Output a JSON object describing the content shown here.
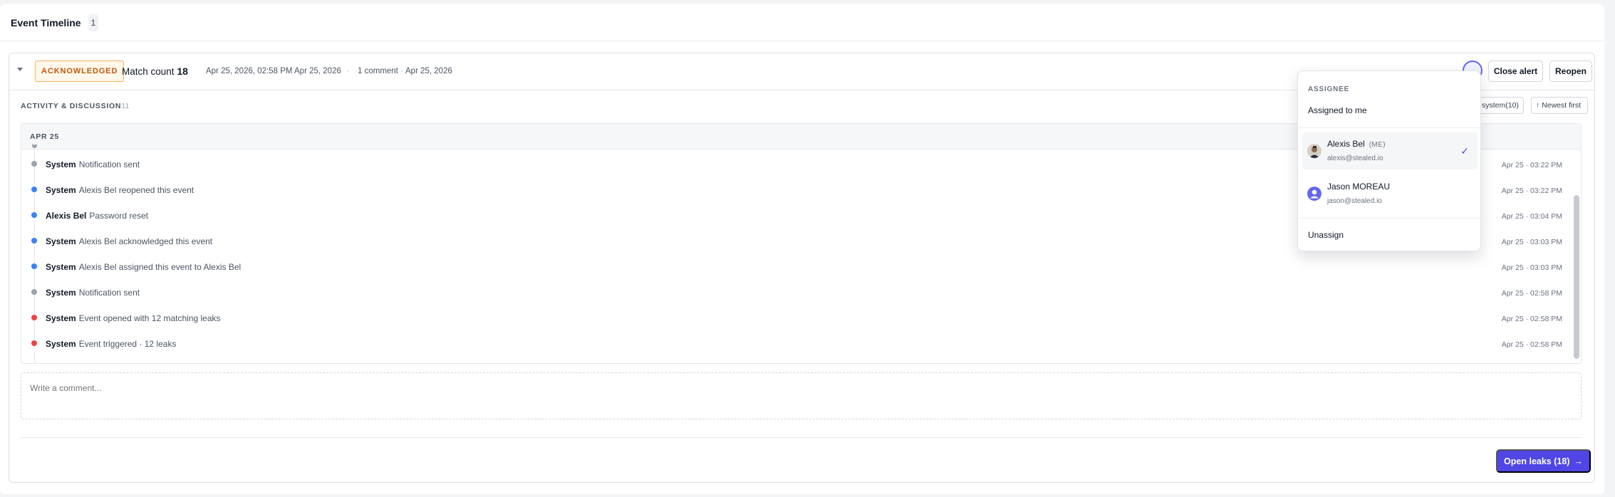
{
  "section": {
    "title": "Event Timeline",
    "count": "1"
  },
  "event": {
    "status": "ACKNOWLEDGED",
    "match_label": "Match count",
    "match_count": "18",
    "first_seen": "Apr 25, 2026, 02:58 PM",
    "last_seen": "Apr 25, 2026",
    "comments": "1 comment",
    "comment_date": "Apr 25, 2026",
    "sep": "·",
    "buttons": {
      "close": "Close alert",
      "reopen": "Reopen"
    }
  },
  "activity": {
    "title": "ACTIVITY & DISCUSSION",
    "count": "· 11",
    "filter_system": "system(10)",
    "sort": "↑ Newest first",
    "date_group": "APR 25",
    "items": [
      {
        "actor": "System",
        "text": "Notification sent",
        "time": "Apr 25 · 03:22 PM",
        "color": "#9ca3af"
      },
      {
        "actor": "System",
        "text": "Alexis Bel reopened this event",
        "time": "Apr 25 · 03:22 PM",
        "color": "#3b82f6"
      },
      {
        "actor": "Alexis Bel",
        "text": "Password reset",
        "time": "Apr 25 · 03:04 PM",
        "color": "#3b82f6"
      },
      {
        "actor": "System",
        "text": "Alexis Bel acknowledged this event",
        "time": "Apr 25 · 03:03 PM",
        "color": "#3b82f6"
      },
      {
        "actor": "System",
        "text": "Alexis Bel assigned this event to Alexis Bel",
        "time": "Apr 25 · 03:03 PM",
        "color": "#3b82f6"
      },
      {
        "actor": "System",
        "text": "Notification sent",
        "time": "Apr 25 · 02:58 PM",
        "color": "#9ca3af"
      },
      {
        "actor": "System",
        "text": "Event opened with 12 matching leaks",
        "time": "Apr 25 · 02:58 PM",
        "color": "#ef4444"
      },
      {
        "actor": "System",
        "text": "Event triggered · 12 leaks",
        "time": "Apr 25 · 02:58 PM",
        "color": "#ef4444"
      }
    ]
  },
  "comment": {
    "placeholder": "Write a comment..."
  },
  "footer": {
    "open_leaks": "Open leaks  (18)",
    "arrow": "→"
  },
  "assignee_menu": {
    "header": "ASSIGNEE",
    "assigned_to_me": "Assigned to me",
    "users": [
      {
        "name": "Alexis Bel",
        "me": "(ME)",
        "email": "alexis@stealed.io",
        "selected": true,
        "avatar_icon": "user-photo-icon"
      },
      {
        "name": "Jason MOREAU",
        "me": "",
        "email": "jason@stealed.io",
        "selected": false,
        "avatar_icon": "user-default-icon"
      }
    ],
    "check": "✓",
    "unassign": "Unassign"
  }
}
